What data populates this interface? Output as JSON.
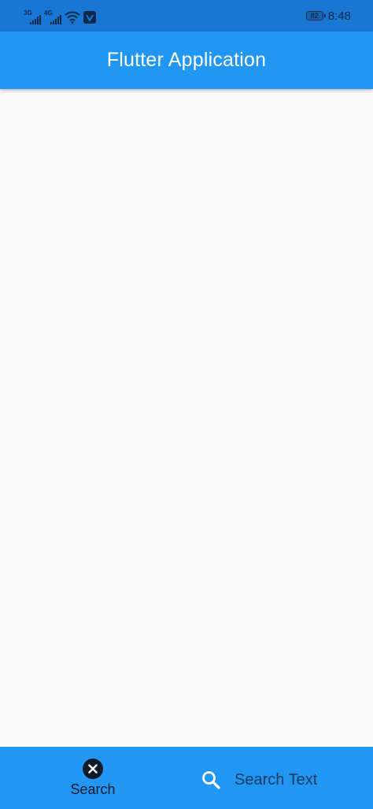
{
  "status_bar": {
    "signal_1_tag": "3G",
    "signal_2_tag": "4G",
    "battery_level": "82",
    "time": "8:48"
  },
  "app_bar": {
    "title": "Flutter Application"
  },
  "bottom_bar": {
    "search_label": "Search",
    "search_placeholder": "Search Text"
  },
  "colors": {
    "status_bar": "#1976D2",
    "app_bar": "#2196F3",
    "background": "#FAFAFA",
    "icon_dark": "#0D1B2A"
  }
}
